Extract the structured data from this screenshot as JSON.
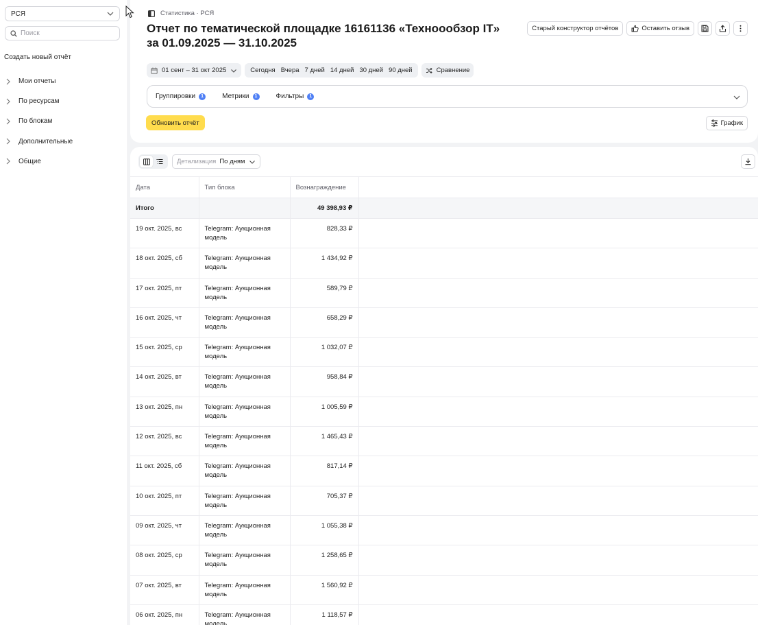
{
  "sidebar": {
    "service_select": "РСЯ",
    "search_placeholder": "Поиск",
    "create_report": "Создать новый отчёт",
    "items": [
      {
        "label": "Мои отчеты"
      },
      {
        "label": "По ресурсам"
      },
      {
        "label": "По блокам"
      },
      {
        "label": "Дополнительные"
      },
      {
        "label": "Общие"
      }
    ]
  },
  "header": {
    "breadcrumb": "Статистика · РСЯ",
    "title": "Отчет по тематической площадке 16161136 «Техноообзор IT» за 01.09.2025 — 31.10.2025",
    "old_builder": "Старый конструктор отчётов",
    "feedback": "Оставить отзыв"
  },
  "period": {
    "range": "01 сент – 31 окт 2025",
    "presets": [
      "Сегодня",
      "Вчера",
      "7 дней",
      "14 дней",
      "30 дней",
      "90 дней"
    ],
    "compare": "Сравнение"
  },
  "settings": {
    "groupings": "Группировки",
    "groupings_count": "1",
    "metrics": "Метрики",
    "metrics_count": "1",
    "filters": "Фильтры",
    "filters_count": "1"
  },
  "actions": {
    "refresh": "Обновить отчёт",
    "graph": "График"
  },
  "table_toolbar": {
    "detail_label": "Детализация",
    "detail_value": "По дням"
  },
  "table": {
    "columns": [
      "Дата",
      "Тип блока",
      "Вознаграждение"
    ],
    "total_label": "Итого",
    "total_value": "49 398,93 ₽",
    "rows": [
      {
        "date": "19 окт. 2025, вс",
        "type": "Telegram: Аукционная модель",
        "reward": "828,33 ₽"
      },
      {
        "date": "18 окт. 2025, сб",
        "type": "Telegram: Аукционная модель",
        "reward": "1 434,92 ₽"
      },
      {
        "date": "17 окт. 2025, пт",
        "type": "Telegram: Аукционная модель",
        "reward": "589,79 ₽"
      },
      {
        "date": "16 окт. 2025, чт",
        "type": "Telegram: Аукционная модель",
        "reward": "658,29 ₽"
      },
      {
        "date": "15 окт. 2025, ср",
        "type": "Telegram: Аукционная модель",
        "reward": "1 032,07 ₽"
      },
      {
        "date": "14 окт. 2025, вт",
        "type": "Telegram: Аукционная модель",
        "reward": "958,84 ₽"
      },
      {
        "date": "13 окт. 2025, пн",
        "type": "Telegram: Аукционная модель",
        "reward": "1 005,59 ₽"
      },
      {
        "date": "12 окт. 2025, вс",
        "type": "Telegram: Аукционная модель",
        "reward": "1 465,43 ₽"
      },
      {
        "date": "11 окт. 2025, сб",
        "type": "Telegram: Аукционная модель",
        "reward": "817,14 ₽"
      },
      {
        "date": "10 окт. 2025, пт",
        "type": "Telegram: Аукционная модель",
        "reward": "705,37 ₽"
      },
      {
        "date": "09 окт. 2025, чт",
        "type": "Telegram: Аукционная модель",
        "reward": "1 055,38 ₽"
      },
      {
        "date": "08 окт. 2025, ср",
        "type": "Telegram: Аукционная модель",
        "reward": "1 258,65 ₽"
      },
      {
        "date": "07 окт. 2025, вт",
        "type": "Telegram: Аукционная модель",
        "reward": "1 560,92 ₽"
      },
      {
        "date": "06 окт. 2025, пн",
        "type": "Telegram: Аукционная модель",
        "reward": "1 118,57 ₽"
      }
    ]
  },
  "colors": {
    "accent_yellow": "#ffdc4d",
    "badge_blue": "#4e7ff5"
  }
}
